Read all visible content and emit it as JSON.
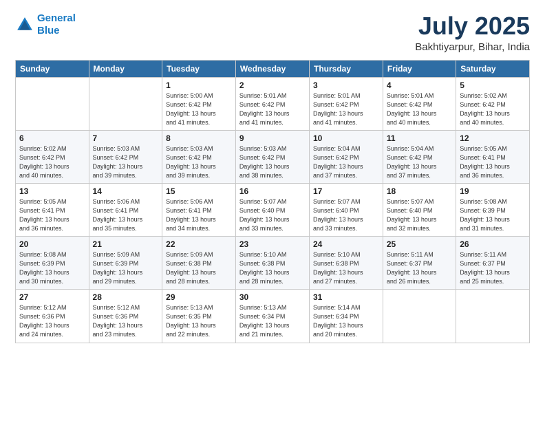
{
  "header": {
    "logo_line1": "General",
    "logo_line2": "Blue",
    "month": "July 2025",
    "location": "Bakhtiyarpur, Bihar, India"
  },
  "weekdays": [
    "Sunday",
    "Monday",
    "Tuesday",
    "Wednesday",
    "Thursday",
    "Friday",
    "Saturday"
  ],
  "weeks": [
    [
      {
        "day": "",
        "info": ""
      },
      {
        "day": "",
        "info": ""
      },
      {
        "day": "1",
        "info": "Sunrise: 5:00 AM\nSunset: 6:42 PM\nDaylight: 13 hours\nand 41 minutes."
      },
      {
        "day": "2",
        "info": "Sunrise: 5:01 AM\nSunset: 6:42 PM\nDaylight: 13 hours\nand 41 minutes."
      },
      {
        "day": "3",
        "info": "Sunrise: 5:01 AM\nSunset: 6:42 PM\nDaylight: 13 hours\nand 41 minutes."
      },
      {
        "day": "4",
        "info": "Sunrise: 5:01 AM\nSunset: 6:42 PM\nDaylight: 13 hours\nand 40 minutes."
      },
      {
        "day": "5",
        "info": "Sunrise: 5:02 AM\nSunset: 6:42 PM\nDaylight: 13 hours\nand 40 minutes."
      }
    ],
    [
      {
        "day": "6",
        "info": "Sunrise: 5:02 AM\nSunset: 6:42 PM\nDaylight: 13 hours\nand 40 minutes."
      },
      {
        "day": "7",
        "info": "Sunrise: 5:03 AM\nSunset: 6:42 PM\nDaylight: 13 hours\nand 39 minutes."
      },
      {
        "day": "8",
        "info": "Sunrise: 5:03 AM\nSunset: 6:42 PM\nDaylight: 13 hours\nand 39 minutes."
      },
      {
        "day": "9",
        "info": "Sunrise: 5:03 AM\nSunset: 6:42 PM\nDaylight: 13 hours\nand 38 minutes."
      },
      {
        "day": "10",
        "info": "Sunrise: 5:04 AM\nSunset: 6:42 PM\nDaylight: 13 hours\nand 37 minutes."
      },
      {
        "day": "11",
        "info": "Sunrise: 5:04 AM\nSunset: 6:42 PM\nDaylight: 13 hours\nand 37 minutes."
      },
      {
        "day": "12",
        "info": "Sunrise: 5:05 AM\nSunset: 6:41 PM\nDaylight: 13 hours\nand 36 minutes."
      }
    ],
    [
      {
        "day": "13",
        "info": "Sunrise: 5:05 AM\nSunset: 6:41 PM\nDaylight: 13 hours\nand 36 minutes."
      },
      {
        "day": "14",
        "info": "Sunrise: 5:06 AM\nSunset: 6:41 PM\nDaylight: 13 hours\nand 35 minutes."
      },
      {
        "day": "15",
        "info": "Sunrise: 5:06 AM\nSunset: 6:41 PM\nDaylight: 13 hours\nand 34 minutes."
      },
      {
        "day": "16",
        "info": "Sunrise: 5:07 AM\nSunset: 6:40 PM\nDaylight: 13 hours\nand 33 minutes."
      },
      {
        "day": "17",
        "info": "Sunrise: 5:07 AM\nSunset: 6:40 PM\nDaylight: 13 hours\nand 33 minutes."
      },
      {
        "day": "18",
        "info": "Sunrise: 5:07 AM\nSunset: 6:40 PM\nDaylight: 13 hours\nand 32 minutes."
      },
      {
        "day": "19",
        "info": "Sunrise: 5:08 AM\nSunset: 6:39 PM\nDaylight: 13 hours\nand 31 minutes."
      }
    ],
    [
      {
        "day": "20",
        "info": "Sunrise: 5:08 AM\nSunset: 6:39 PM\nDaylight: 13 hours\nand 30 minutes."
      },
      {
        "day": "21",
        "info": "Sunrise: 5:09 AM\nSunset: 6:39 PM\nDaylight: 13 hours\nand 29 minutes."
      },
      {
        "day": "22",
        "info": "Sunrise: 5:09 AM\nSunset: 6:38 PM\nDaylight: 13 hours\nand 28 minutes."
      },
      {
        "day": "23",
        "info": "Sunrise: 5:10 AM\nSunset: 6:38 PM\nDaylight: 13 hours\nand 28 minutes."
      },
      {
        "day": "24",
        "info": "Sunrise: 5:10 AM\nSunset: 6:38 PM\nDaylight: 13 hours\nand 27 minutes."
      },
      {
        "day": "25",
        "info": "Sunrise: 5:11 AM\nSunset: 6:37 PM\nDaylight: 13 hours\nand 26 minutes."
      },
      {
        "day": "26",
        "info": "Sunrise: 5:11 AM\nSunset: 6:37 PM\nDaylight: 13 hours\nand 25 minutes."
      }
    ],
    [
      {
        "day": "27",
        "info": "Sunrise: 5:12 AM\nSunset: 6:36 PM\nDaylight: 13 hours\nand 24 minutes."
      },
      {
        "day": "28",
        "info": "Sunrise: 5:12 AM\nSunset: 6:36 PM\nDaylight: 13 hours\nand 23 minutes."
      },
      {
        "day": "29",
        "info": "Sunrise: 5:13 AM\nSunset: 6:35 PM\nDaylight: 13 hours\nand 22 minutes."
      },
      {
        "day": "30",
        "info": "Sunrise: 5:13 AM\nSunset: 6:34 PM\nDaylight: 13 hours\nand 21 minutes."
      },
      {
        "day": "31",
        "info": "Sunrise: 5:14 AM\nSunset: 6:34 PM\nDaylight: 13 hours\nand 20 minutes."
      },
      {
        "day": "",
        "info": ""
      },
      {
        "day": "",
        "info": ""
      }
    ]
  ]
}
